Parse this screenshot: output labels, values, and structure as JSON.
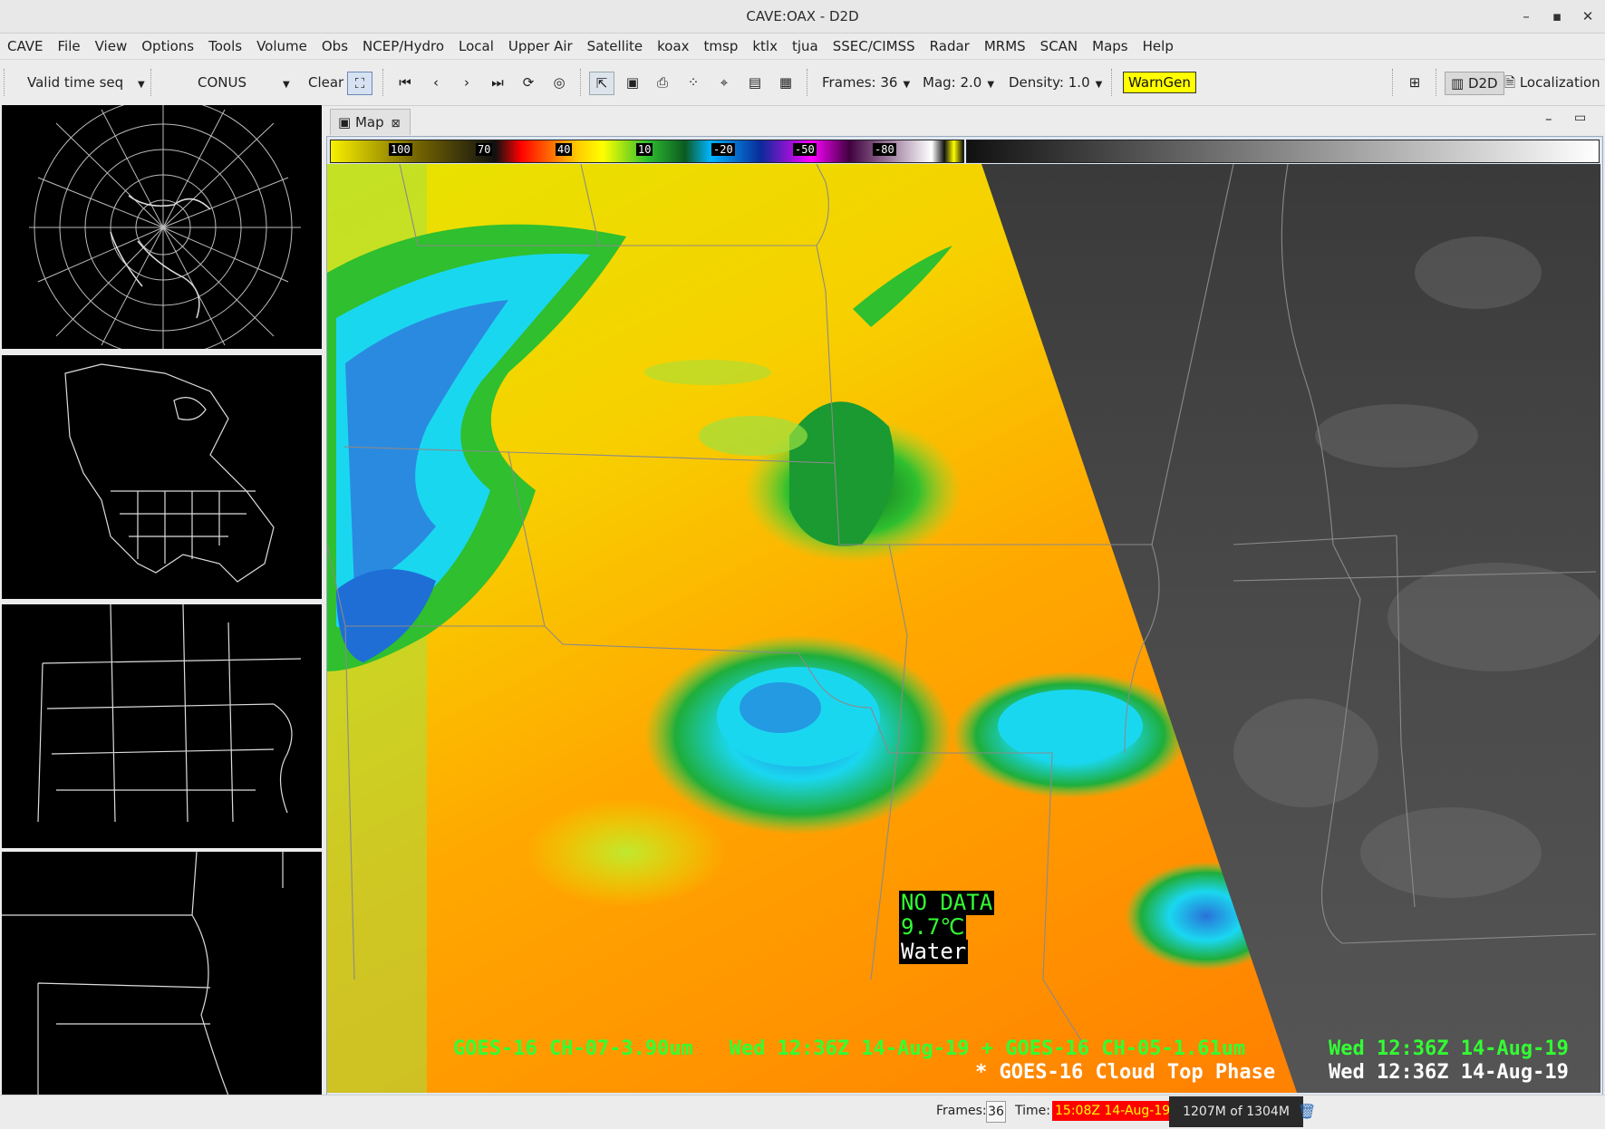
{
  "window": {
    "title": "CAVE:OAX - D2D",
    "minimize": "–",
    "maximize": "▪",
    "close": "✕"
  },
  "menu": [
    "CAVE",
    "File",
    "View",
    "Options",
    "Tools",
    "Volume",
    "Obs",
    "NCEP/Hydro",
    "Local",
    "Upper Air",
    "Satellite",
    "koax",
    "tmsp",
    "ktlx",
    "tjua",
    "SSEC/CIMSS",
    "Radar",
    "MRMS",
    "SCAN",
    "Maps",
    "Help"
  ],
  "toolbar": {
    "time_mode": "Valid time seq",
    "scale": "CONUS",
    "clear_label": "Clear",
    "frames_label": "Frames: 36",
    "mag_label": "Mag: 2.0",
    "density_label": "Density: 1.0",
    "warngen_label": "WarnGen",
    "perspective_d2d": "D2D",
    "perspective_localization": "Localization"
  },
  "map_tab": {
    "label": "Map"
  },
  "colorbar": {
    "labels": [
      "100",
      "70",
      "40",
      "10",
      "-20",
      "-50",
      "-80"
    ]
  },
  "readout": {
    "line1": "NO DATA",
    "line2": "9.7℃",
    "line3": "Water"
  },
  "legend": {
    "line1_left": "GOES-16 CH-07-3.90um   Wed 12:36Z 14-Aug-19 + GOES-16 CH-05-1.61um",
    "line1_right": "Wed 12:36Z 14-Aug-19",
    "line2_left": "* GOES-16 Cloud Top Phase",
    "line2_right": "Wed 12:36Z 14-Aug-19"
  },
  "status": {
    "frames_label": "Frames:",
    "frames_value": "36",
    "time_label": "Time:",
    "time_value": "15:08Z 14-Aug-19",
    "memory": "1207M of 1304M"
  },
  "colors": {
    "ir_warm": "#ff8a00",
    "ir_yellow": "#f2e600",
    "ir_green": "#2fbf2f",
    "ir_cyan": "#1ad7f0",
    "ir_blue": "#1f7de0",
    "warngen_bg": "#ffff00",
    "legend_green": "#33ff33",
    "time_bg": "#ff0000"
  }
}
